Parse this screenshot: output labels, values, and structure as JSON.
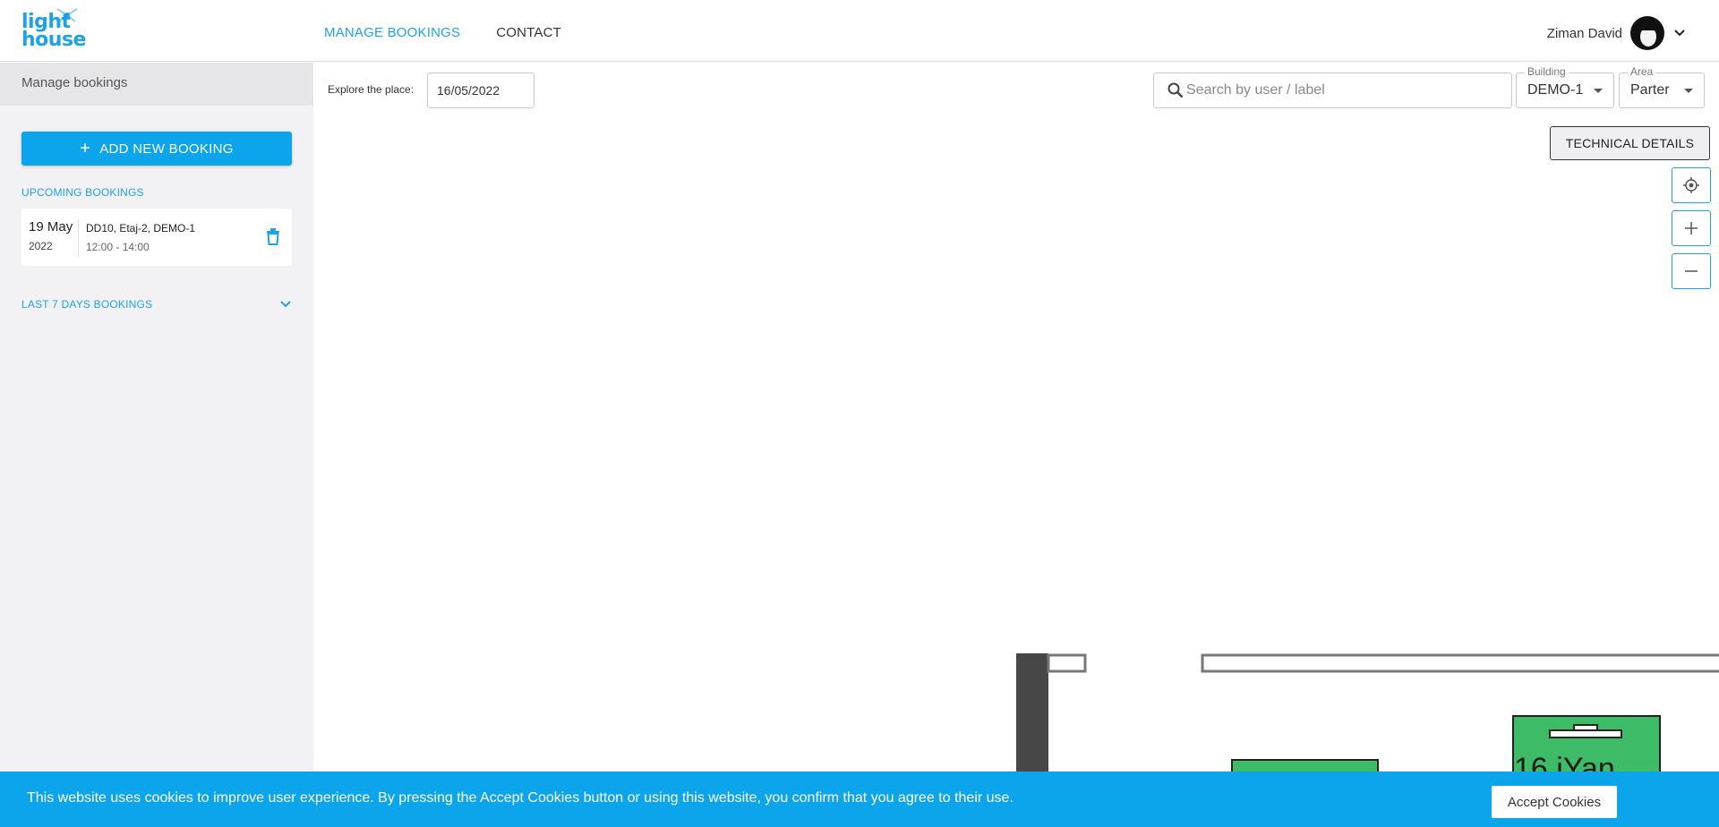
{
  "header": {
    "logo": {
      "line1": "light",
      "line2": "house"
    },
    "nav": [
      {
        "label": "MANAGE BOOKINGS",
        "active": true
      },
      {
        "label": "CONTACT",
        "active": false
      }
    ],
    "user_name": "Ziman David"
  },
  "sidebar": {
    "title": "Manage bookings",
    "add_button_label": "ADD NEW BOOKING",
    "upcoming_label": "UPCOMING BOOKINGS",
    "bookings": [
      {
        "day": "19 May",
        "year": "2022",
        "place": "DD10, Etaj-2, DEMO-1",
        "time": "12:00 - 14:00"
      }
    ],
    "last7_label": "LAST 7 DAYS BOOKINGS"
  },
  "main": {
    "explore_label": "Explore the place:",
    "date_value": "16/05/2022",
    "search_placeholder": "Search by user / label",
    "building": {
      "legend": "Building",
      "value": "DEMO-1"
    },
    "area": {
      "legend": "Area",
      "value": "Parter"
    },
    "technical_details_label": "TECHNICAL DETAILS",
    "map": {
      "desk_label": "16 iYan",
      "desk_color": "#3dbb66",
      "accent": "#1ea1e6"
    }
  },
  "cookie": {
    "text": "This website uses cookies to improve user experience. By pressing the Accept Cookies button or using this website, you confirm that you agree to their use.",
    "button_label": "Accept Cookies"
  },
  "colors": {
    "primary": "#1ea1e6",
    "banner": "#0ca4ea",
    "desk": "#3dbb66"
  }
}
